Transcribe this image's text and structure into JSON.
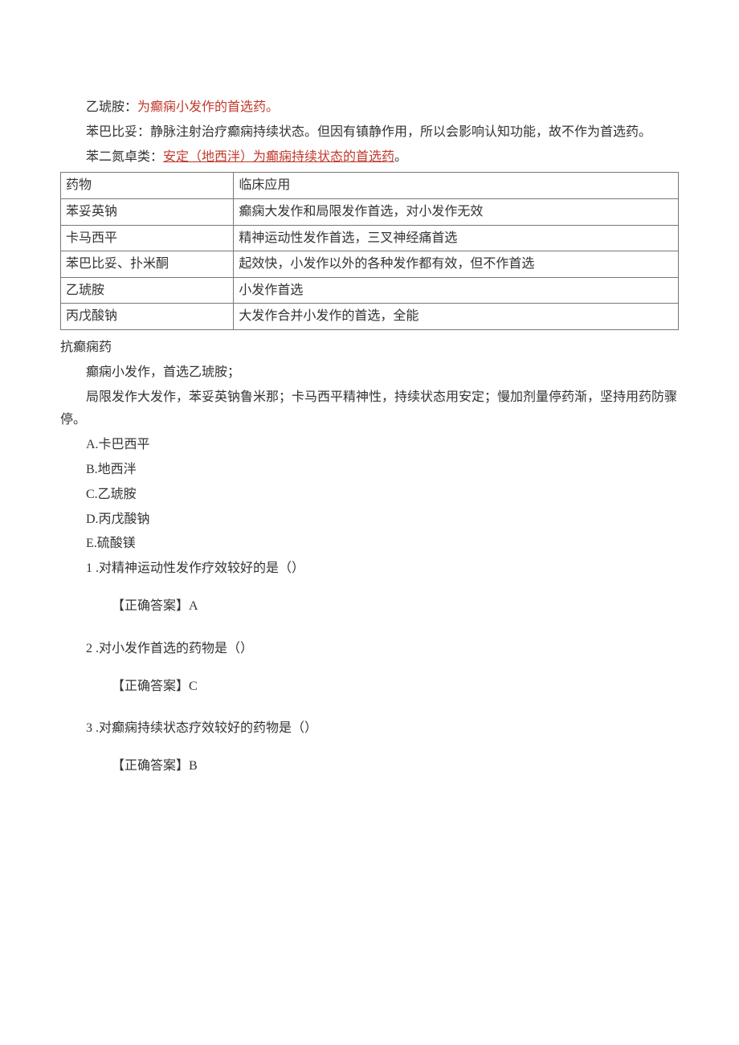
{
  "intro": {
    "line1_pre": "乙琥胺：",
    "line1_red": "为癫痫小发作的首选药。",
    "line2": "苯巴比妥：静脉注射治疗癫痫持续状态。但因有镇静作用，所以会影响认知功能，故不作为首选药。",
    "line3_pre": "苯二氮卓类：",
    "line3_red": "安定（地西泮）为癫痫持续状态的首选药",
    "line3_post": "。"
  },
  "table": {
    "header": {
      "drug": "药物",
      "app": "临床应用"
    },
    "rows": [
      {
        "drug": "苯妥英钠",
        "app": "癫痫大发作和局限发作首选，对小发作无效"
      },
      {
        "drug": "卡马西平",
        "app": "精神运动性发作首选，三叉神经痛首选"
      },
      {
        "drug": "苯巴比妥、扑米酮",
        "app": "起效快，小发作以外的各种发作都有效，但不作首选"
      },
      {
        "drug": "乙琥胺",
        "app": "小发作首选"
      },
      {
        "drug": "丙戊酸钠",
        "app": "大发作合并小发作的首选，全能"
      }
    ]
  },
  "section_title": "抗癫痫药",
  "mnemonic": {
    "line1": "癫痫小发作，首选乙琥胺；",
    "line2": "局限发作大发作，苯妥英钠鲁米那；卡马西平精神性，持续状态用安定；慢加剂量停药渐，坚持用药防骤停。"
  },
  "options": {
    "A": "A.卡巴西平",
    "B": "B.地西泮",
    "C": "C.乙琥胺",
    "D": "D.丙戊酸钠",
    "E": "E.硫酸镁"
  },
  "questions": [
    {
      "num": "1 .",
      "text": "对精神运动性发作疗效较好的是（）",
      "answer": "【正确答案】A"
    },
    {
      "num": "2 .",
      "text": "对小发作首选的药物是（）",
      "answer": "【正确答案】C"
    },
    {
      "num": "3 .",
      "text": "对癫痫持续状态疗效较好的药物是（）",
      "answer": "【正确答案】B"
    }
  ]
}
